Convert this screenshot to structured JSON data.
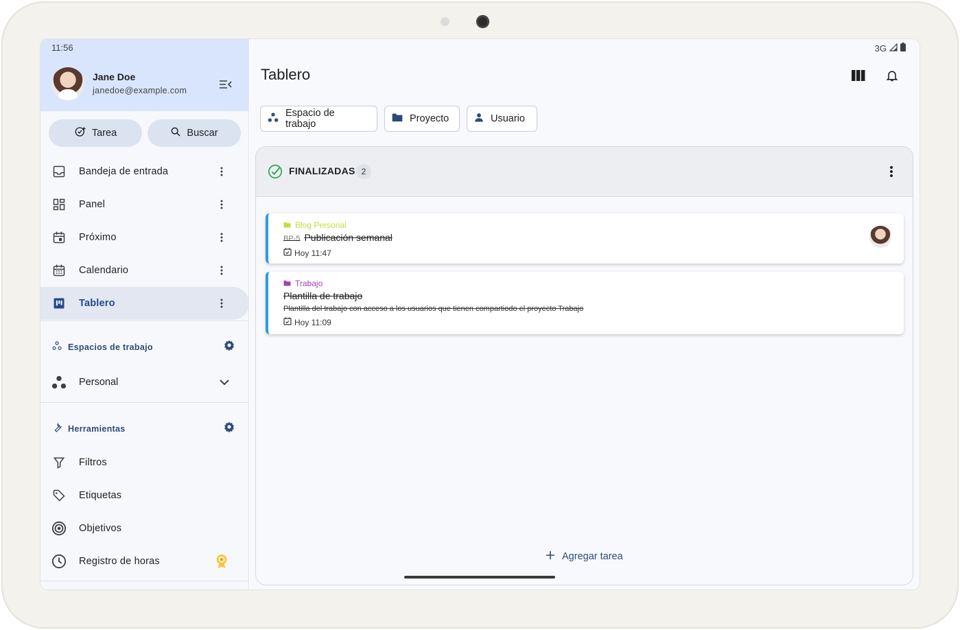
{
  "status_bar": {
    "time": "11:56",
    "network": "3G"
  },
  "user": {
    "name": "Jane Doe",
    "email": "janedoe@example.com"
  },
  "actions": {
    "task_label": "Tarea",
    "search_label": "Buscar"
  },
  "nav": {
    "items": [
      {
        "label": "Bandeja de entrada",
        "icon": "inbox-icon"
      },
      {
        "label": "Panel",
        "icon": "dashboard-icon"
      },
      {
        "label": "Próximo",
        "icon": "calendar-today-icon"
      },
      {
        "label": "Calendario",
        "icon": "calendar-month-icon"
      },
      {
        "label": "Tablero",
        "icon": "board-icon",
        "active": true
      }
    ]
  },
  "workspaces": {
    "header": "Espacios de trabajo",
    "current": "Personal"
  },
  "tools": {
    "header": "Herramientas",
    "items": [
      {
        "label": "Filtros",
        "icon": "filter-icon"
      },
      {
        "label": "Etiquetas",
        "icon": "tag-icon"
      },
      {
        "label": "Objetivos",
        "icon": "target-icon"
      },
      {
        "label": "Registro de horas",
        "icon": "clock-icon"
      }
    ]
  },
  "page": {
    "title": "Tablero"
  },
  "filters": {
    "workspace": "Espacio de trabajo",
    "project": "Proyecto",
    "user": "Usuario"
  },
  "column": {
    "title": "FINALIZADAS",
    "count": "2"
  },
  "cards": [
    {
      "project": "Blog Personal",
      "project_color": "#c7da3e",
      "task_id": "BP-5",
      "title": "Publicación semanal",
      "date": "Hoy 11:47"
    },
    {
      "project": "Trabajo",
      "project_color": "#a43fb5",
      "title": "Plantilla de trabajo",
      "description": "Plantilla del trabajo con acceso a los usuarios que tienen compartiodo el proyecto Trabajo",
      "date": "Hoy 11:09"
    }
  ],
  "add_task_label": "Agregar tarea",
  "colors": {
    "accent": "#2e4a7a",
    "card_border": "#2b9be0",
    "check": "#3aa757",
    "sidebar_header": "#d9e5fd"
  }
}
